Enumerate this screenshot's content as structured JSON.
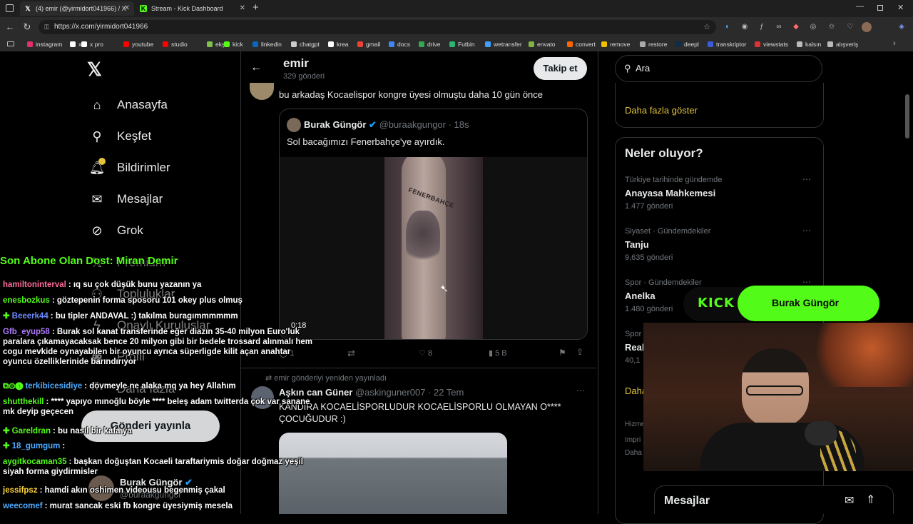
{
  "browser": {
    "tabs": [
      {
        "title": "(4) emir (@yirmidort041966) / X",
        "icon": "x-logo-icon"
      },
      {
        "title": "Stream - Kick Dashboard",
        "icon": "kick-logo-icon"
      }
    ],
    "url": "https://x.com/yirmidort041966",
    "bookmarks": [
      {
        "label": "instagram",
        "color": "#e1306c"
      },
      {
        "label": "x",
        "color": "#ffffff"
      },
      {
        "label": "x pro",
        "color": "#ffffff"
      },
      {
        "label": "youtube",
        "color": "#ff0000"
      },
      {
        "label": "studio",
        "color": "#ff0000"
      },
      {
        "label": "ekşi",
        "color": "#81c14b"
      },
      {
        "label": "kick",
        "color": "#53fc18"
      },
      {
        "label": "linkedin",
        "color": "#0a66c2"
      },
      {
        "label": "chatgpt",
        "color": "#cccccc"
      },
      {
        "label": "krea",
        "color": "#ffffff"
      },
      {
        "label": "gmail",
        "color": "#ea4335"
      },
      {
        "label": "docs",
        "color": "#4285f4"
      },
      {
        "label": "drive",
        "color": "#34a853"
      },
      {
        "label": "Futbin",
        "color": "#2bb673"
      },
      {
        "label": "wetransfer",
        "color": "#409fff"
      },
      {
        "label": "envato",
        "color": "#81b441"
      },
      {
        "label": "convert",
        "color": "#ff6600"
      },
      {
        "label": "remove",
        "color": "#f0c000"
      },
      {
        "label": "restore",
        "color": "#aaaaaa"
      },
      {
        "label": "deepl",
        "color": "#0f2b46"
      },
      {
        "label": "transkriptor",
        "color": "#3b5bdb"
      },
      {
        "label": "viewstats",
        "color": "#e03131"
      },
      {
        "label": "kalsın",
        "color": "#bbbbbb"
      },
      {
        "label": "alışveriş",
        "color": "#bbbbbb"
      }
    ]
  },
  "sidebar": {
    "items": [
      {
        "label": "Anasayfa",
        "icon": "home-icon"
      },
      {
        "label": "Keşfet",
        "icon": "search-icon"
      },
      {
        "label": "Bildirimler",
        "icon": "bell-icon"
      },
      {
        "label": "Mesajlar",
        "icon": "mail-icon"
      },
      {
        "label": "Grok",
        "icon": "grok-icon"
      },
      {
        "label": "Premium",
        "icon": "x-logo-icon"
      },
      {
        "label": "Topluluklar",
        "icon": "people-icon"
      },
      {
        "label": "Onaylı Kuruluşlar",
        "icon": "lightning-icon"
      },
      {
        "label": "Profil",
        "icon": "person-icon"
      },
      {
        "label": "Daha fazla",
        "icon": "more-icon"
      }
    ],
    "post_button": "Gönderi yayınla",
    "account_name": "Burak Güngör",
    "account_handle": "@buraakgungor"
  },
  "profile": {
    "name": "emir",
    "posts": "329 gönderi",
    "follow_label": "Takip et"
  },
  "tweet1": {
    "text": "bu arkadaş Kocaelispor kongre üyesi olmuştu daha 10 gün önce",
    "quote_name": "Burak Güngör",
    "quote_handle": "@buraakgungor · 18s",
    "quote_text": "Sol bacağımızı Fenerbahçe'ye ayırdık.",
    "video_time": "0:18",
    "tattoo_text": "FENERBAHÇE",
    "replies": "1",
    "likes": "8",
    "views": "5 B"
  },
  "tweet2": {
    "repost_note": "emir gönderiyi yeniden yayınladı",
    "name": "Aşkın can Güner",
    "handle": "@askinguner007 · 22 Tem",
    "text": "KANDIRA KOCAELİSPORLUDUR KOCAELİSPORLU OLMAYAN O**** ÇOCUĞUDUR :)"
  },
  "right": {
    "search_placeholder": "Ara",
    "show_more": "Daha fazla göster",
    "trends_title": "Neler oluyor?",
    "trends": [
      {
        "context": "Türkiye tarihinde gündemde",
        "name": "Anayasa Mahkemesi",
        "count": "1.477 gönderi"
      },
      {
        "context": "Siyaset · Gündemdekiler",
        "name": "Tanju",
        "count": "9,635 gönderi"
      },
      {
        "context": "Spor · Gündemdekiler",
        "name": "Anelka",
        "count": "1.480 gönderi"
      },
      {
        "context": "Spor",
        "name": "Real",
        "count": "40,1"
      }
    ],
    "show_more2": "Daha",
    "footer1": "Hizme",
    "footer2": "Impri",
    "footer3": "Daha",
    "messages_title": "Mesajlar"
  },
  "overlay": {
    "subscriber_banner": "Son Abone Olan Dost: Miran Demir",
    "kick_label": "KICK",
    "streamer_name": "Burak Güngör",
    "chat": [
      {
        "user": "hamiltoninterval",
        "color": "#ff6b9a",
        "msg": ": ıq su çok düşük bunu yazanın ya",
        "badge": ""
      },
      {
        "user": "enesbozkus",
        "color": "#53fc18",
        "msg": ": göztepenin forma sposoru 101 okey plus olmuş",
        "badge": ""
      },
      {
        "user": "Beeerk44",
        "color": "#6e8bff",
        "msg": ": bu tipler ANDAVAL :) takılma buragımmmmmm",
        "badge": "✚"
      },
      {
        "user": "Gfb_eyup58",
        "color": "#b07cff",
        "msg": ": Burak sol kanat transferinde eğer diazın 35-40 milyon Euro'luk paralara çıkamayacaksak bence 20 milyon gibi bir bedele trossard alınmalı hem cogu mevkide oynayabilen bir oyuncu ayrıca süperligde kilit açan anahtar oyuncu özelliklerinide barındırıyor",
        "badge": ""
      },
      {
        "user": "terkibicesidiye",
        "color": "#4dabff",
        "msg": ": dövmeyle ne alaka mq ya hey Allahım",
        "badge": "⧉⚙➊"
      },
      {
        "user": "shutthekill",
        "color": "#53fc18",
        "msg": ": **** yapıyo mınoğlu böyle **** beleş adam twitterda çok var sanane mk deyip geçecen",
        "badge": ""
      },
      {
        "user": "Gareldran",
        "color": "#53fc18",
        "msg": ": bu nasıl bir kafa ya",
        "badge": "✚"
      },
      {
        "user": "18_gumgum",
        "color": "#4dabff",
        "msg": ":",
        "badge": "✚"
      },
      {
        "user": "aygitkocaman35",
        "color": "#53fc18",
        "msg": ": başkan doğuştan Kocaeli taraftariymis doğar doğmaz yeşil siyah forma giydirmisler",
        "badge": ""
      },
      {
        "user": "jessifpsz",
        "color": "#ffd43b",
        "msg": ": hamdi akın oshimen videousu begenmiş çakal",
        "badge": ""
      },
      {
        "user": "weecomef",
        "color": "#4dabff",
        "msg": ": murat sancak eski fb kongre üyesiymiş mesela",
        "badge": ""
      }
    ]
  },
  "colors": {
    "accent": "#1d9bf0",
    "kick_green": "#53fc18",
    "link_yellow": "#e2c33c"
  }
}
